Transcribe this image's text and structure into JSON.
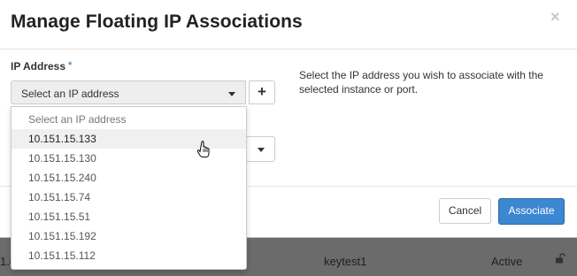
{
  "modal": {
    "title": "Manage Floating IP Associations",
    "close_symbol": "×"
  },
  "ip_field": {
    "label": "IP Address",
    "required_mark": "*",
    "selected_value": "Select an IP address",
    "add_symbol": "+"
  },
  "help_text": "Select the IP address you wish to associate with the selected instance or port.",
  "dropdown_options": [
    "Select an IP address",
    "10.151.15.133",
    "10.151.15.130",
    "10.151.15.240",
    "10.151.15.74",
    "10.151.15.51",
    "10.151.15.192",
    "10.151.15.112"
  ],
  "footer": {
    "cancel_label": "Cancel",
    "associate_label": "Associate"
  },
  "background_row": {
    "col1": "1.0",
    "name": "keytest1",
    "status": "Active"
  },
  "colors": {
    "primary": "#3b87d1",
    "required": "#5b8fc7"
  }
}
